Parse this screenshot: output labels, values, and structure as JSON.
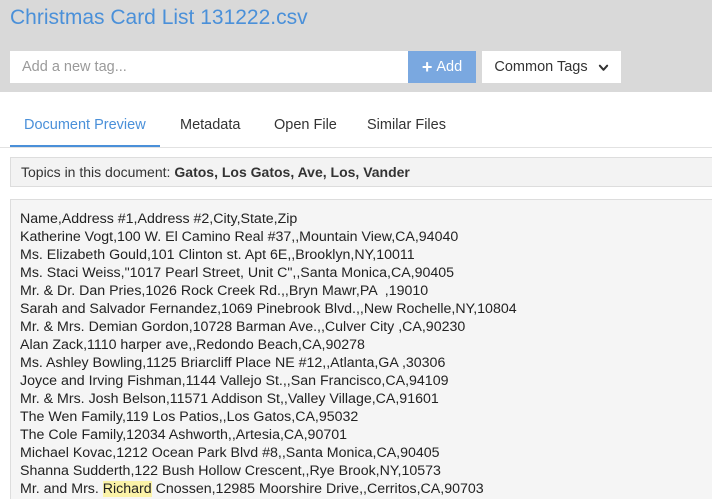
{
  "header": {
    "title": "Christmas Card List 131222.csv",
    "tag_placeholder": "Add a new tag...",
    "add_label": "Add",
    "common_tags_label": "Common Tags"
  },
  "tabs": [
    {
      "label": "Document Preview",
      "active": true
    },
    {
      "label": "Metadata",
      "active": false
    },
    {
      "label": "Open File",
      "active": false
    },
    {
      "label": "Similar Files",
      "active": false
    }
  ],
  "topics": {
    "prefix": "Topics in this document:",
    "values": "Gatos, Los Gatos, Ave, Los, Vander"
  },
  "document": {
    "lines": [
      "Name,Address #1,Address #2,City,State,Zip",
      "Katherine Vogt,100 W. El Camino Real #37,,Mountain View,CA,94040",
      "Ms. Elizabeth Gould,101 Clinton st. Apt 6E,,Brooklyn,NY,10011",
      "Ms. Staci Weiss,\"1017 Pearl Street, Unit C\",,Santa Monica,CA,90405",
      "Mr. & Dr. Dan Pries,1026 Rock Creek Rd.,,Bryn Mawr,PA  ,19010",
      "Sarah and Salvador Fernandez,1069 Pinebrook Blvd.,,New Rochelle,NY,10804",
      "Mr. & Mrs. Demian Gordon,10728 Barman Ave.,,Culver City ,CA,90230",
      "Alan Zack,1110 harper ave,,Redondo Beach,CA,90278",
      "Ms. Ashley Bowling,1125 Briarcliff Place NE #12,,Atlanta,GA ,30306",
      "Joyce and Irving Fishman,1144 Vallejo St.,,San Francisco,CA,94109",
      "Mr. & Mrs. Josh Belson,11571 Addison St,,Valley Village,CA,91601",
      "The Wen Family,119 Los Patios,,Los Gatos,CA,95032",
      "The Cole Family,12034 Ashworth,,Artesia,CA,90701",
      "Michael Kovac,1212 Ocean Park Blvd #8,,Santa Monica,CA,90405",
      "Shanna Sudderth,122 Bush Hollow Crescent,,Rye Brook,NY,10573"
    ],
    "last_line": {
      "before": "Mr. and Mrs. ",
      "highlight": "Richard",
      "after": " Cnossen,12985 Moorshire Drive,,Cerritos,CA,90703"
    }
  },
  "colors": {
    "accent": "#4a90d9",
    "add_button": "#7aa8e0",
    "header_bg": "#d9d9d9",
    "highlight": "#fbf3a8"
  },
  "icons": {
    "add": "plus-icon",
    "dropdown": "chevron-down-icon"
  }
}
